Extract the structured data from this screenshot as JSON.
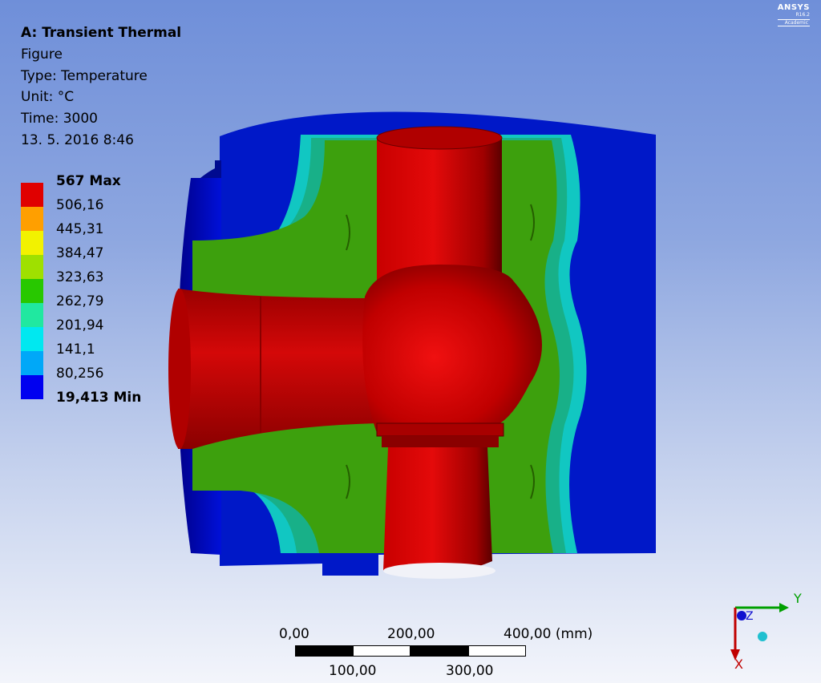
{
  "info": {
    "title": "A: Transient Thermal",
    "figure": "Figure",
    "type": "Type: Temperature",
    "unit": "Unit: °C",
    "time": "Time: 3000",
    "date": "13. 5. 2016 8:46"
  },
  "legend": {
    "max_label": "567 Max",
    "min_label": "19,413 Min",
    "levels": [
      "506,16",
      "445,31",
      "384,47",
      "323,63",
      "262,79",
      "201,94",
      "141,1",
      "80,256"
    ],
    "colors": [
      "#e00000",
      "#ff9f00",
      "#f2f200",
      "#9fe000",
      "#28c800",
      "#20e8a0",
      "#00e8f0",
      "#00a8f8",
      "#0000f0"
    ]
  },
  "logo": {
    "name": "ANSYS",
    "version": "R16.2",
    "edition": "Academic"
  },
  "scale_bar": {
    "top_labels": [
      "0,00",
      "200,00",
      "400,00 (mm)"
    ],
    "bottom_labels": [
      "100,00",
      "300,00"
    ]
  },
  "triad": {
    "x_label": "X",
    "y_label": "Y",
    "z_label": "Z"
  }
}
